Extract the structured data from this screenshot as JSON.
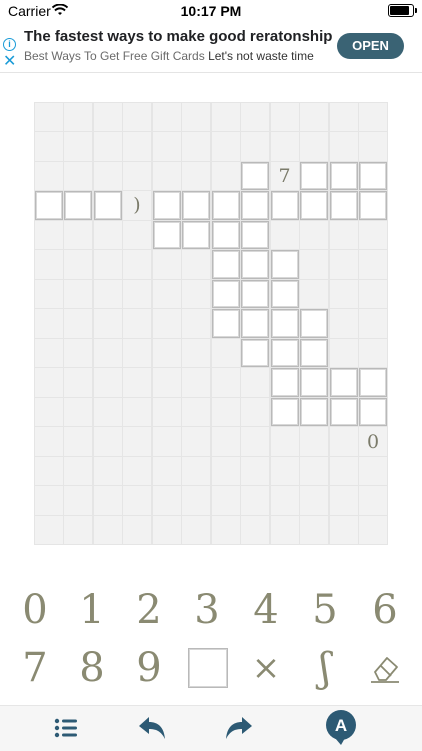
{
  "status_bar": {
    "carrier": "Carrier",
    "time": "10:17 PM"
  },
  "ad": {
    "title": "The fastest ways to make good reratonship",
    "subtitle_left": "Best Ways To Get Free Gift Cards",
    "subtitle_right": "Let's not waste time",
    "cta": "OPEN",
    "info_icon": "i",
    "close_icon": "✕"
  },
  "puzzle": {
    "rows": 15,
    "cols": 12,
    "boxes": [
      [
        2,
        7
      ],
      [
        2,
        9
      ],
      [
        2,
        10
      ],
      [
        2,
        11
      ],
      [
        3,
        0
      ],
      [
        3,
        1
      ],
      [
        3,
        2
      ],
      [
        3,
        4
      ],
      [
        3,
        5
      ],
      [
        3,
        6
      ],
      [
        3,
        7
      ],
      [
        3,
        8
      ],
      [
        3,
        9
      ],
      [
        3,
        10
      ],
      [
        3,
        11
      ],
      [
        4,
        4
      ],
      [
        4,
        5
      ],
      [
        4,
        6
      ],
      [
        4,
        7
      ],
      [
        5,
        6
      ],
      [
        5,
        7
      ],
      [
        5,
        8
      ],
      [
        6,
        6
      ],
      [
        6,
        7
      ],
      [
        6,
        8
      ],
      [
        7,
        6
      ],
      [
        7,
        7
      ],
      [
        7,
        8
      ],
      [
        7,
        9
      ],
      [
        8,
        7
      ],
      [
        8,
        8
      ],
      [
        8,
        9
      ],
      [
        9,
        8
      ],
      [
        9,
        9
      ],
      [
        9,
        10
      ],
      [
        9,
        11
      ],
      [
        10,
        8
      ],
      [
        10,
        9
      ],
      [
        10,
        10
      ],
      [
        10,
        11
      ]
    ],
    "symbols": [
      {
        "row": 2,
        "col": 8,
        "text": "7"
      },
      {
        "row": 3,
        "col": 3,
        "text": ")"
      },
      {
        "row": 11,
        "col": 11,
        "text": "0"
      }
    ]
  },
  "keypad": {
    "row1": [
      "0",
      "1",
      "2",
      "3",
      "4",
      "5",
      "6"
    ],
    "row2": [
      "7",
      "8",
      "9",
      "",
      "×",
      "ʃ",
      ""
    ],
    "row2_names": [
      "key-7",
      "key-8",
      "key-9",
      "key-empty-box",
      "key-multiply",
      "key-bracket",
      "key-eraser"
    ]
  },
  "colors": {
    "symbol": "#8a8a72",
    "toolbar_icon": "#2d5a74",
    "ad_button": "#3a6374"
  }
}
